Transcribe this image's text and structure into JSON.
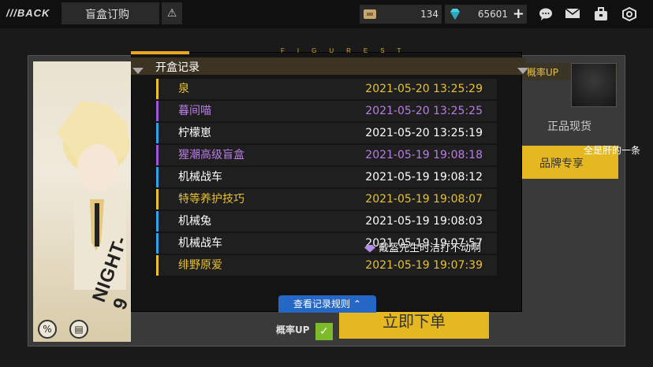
{
  "topbar": {
    "back_label": "BACK",
    "title": "盲盒订购",
    "currency1": {
      "value": "134",
      "icon": "ticket-icon"
    },
    "currency2": {
      "value": "65601",
      "icon": "diamond-icon"
    },
    "icons": [
      "chat-icon",
      "mail-icon",
      "bag-icon",
      "settings-icon"
    ]
  },
  "scene": {
    "char_name": "NIGHT-9",
    "prob_up": "概率UP",
    "genuine": "正品现货",
    "brand": "品牌专享",
    "scrolling_text": "全是肝的一条",
    "buy": "立即下单",
    "bottom_prob_up": "概率UP"
  },
  "modal": {
    "title": "开盒记录",
    "deco": "FIGUREST",
    "rows": [
      {
        "name": "泉",
        "time": "2021-05-20 13:25:29",
        "color": "#e8c233",
        "bar": "#e8c233"
      },
      {
        "name": "暮间喵",
        "time": "2021-05-20 13:25:25",
        "color": "#b97de6",
        "bar": "#9b5bd6"
      },
      {
        "name": "柠檬崽",
        "time": "2021-05-20 13:25:19",
        "color": "#ffffff",
        "bar": "#3aa0e6"
      },
      {
        "name": "猩潮高级盲盒",
        "time": "2021-05-19 19:08:18",
        "color": "#b97de6",
        "bar": "#9b5bd6"
      },
      {
        "name": "机械战车",
        "time": "2021-05-19 19:08:12",
        "color": "#ffffff",
        "bar": "#3aa0e6"
      },
      {
        "name": "特等养护技巧",
        "time": "2021-05-19 19:08:07",
        "color": "#e8c233",
        "bar": "#e8c233"
      },
      {
        "name": "机械兔",
        "time": "2021-05-19 19:08:03",
        "color": "#ffffff",
        "bar": "#3aa0e6"
      },
      {
        "name": "机械战车",
        "time": "2021-05-19 19:07:57",
        "color": "#ffffff",
        "bar": "#3aa0e6"
      },
      {
        "name": "绯野原爱",
        "time": "2021-05-19 19:07:39",
        "color": "#e8c233",
        "bar": "#e8c233"
      }
    ],
    "toast": "戴盔先生时洁打不动啊",
    "rule_button": "查看记录规则"
  }
}
